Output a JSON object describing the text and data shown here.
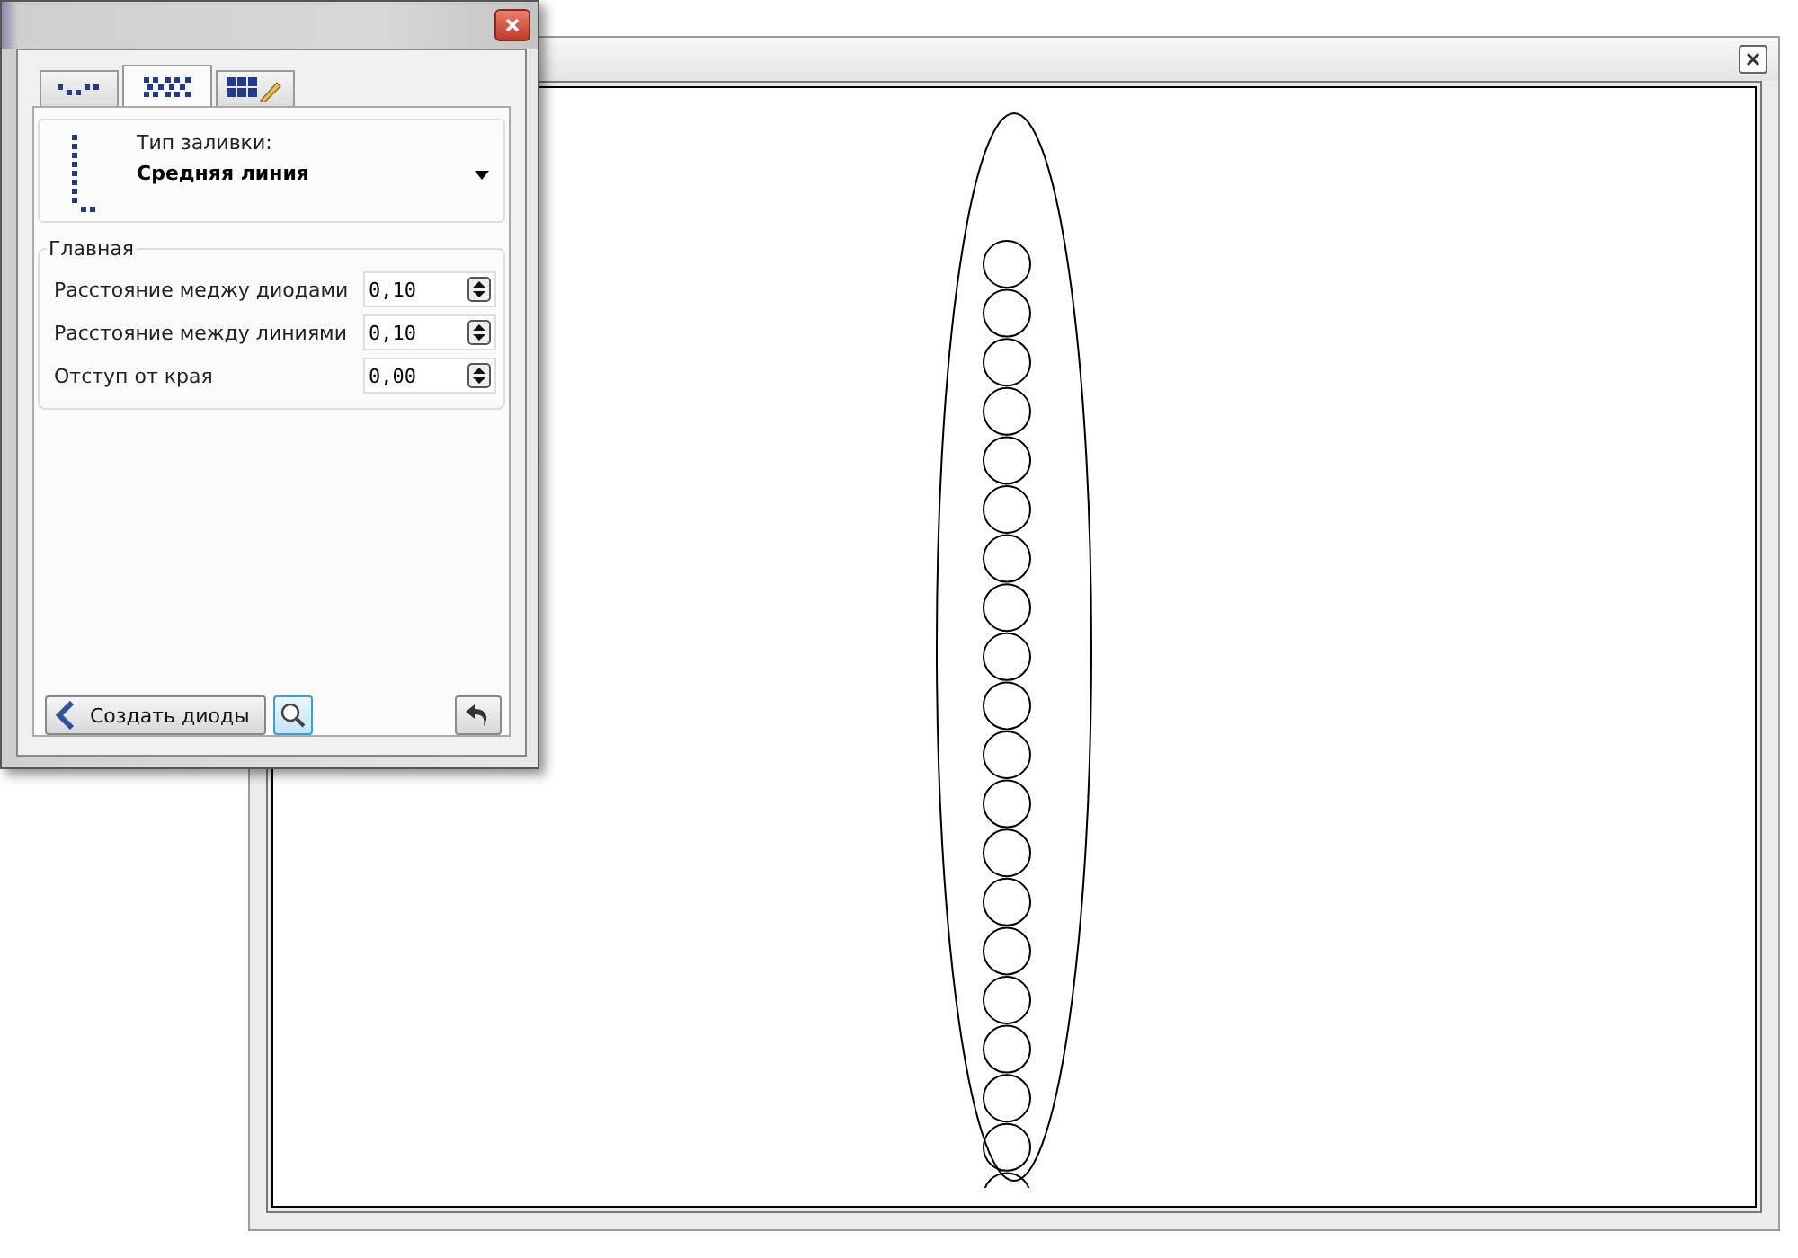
{
  "tabs": [
    {
      "kind": "dots",
      "selected": false
    },
    {
      "kind": "grid",
      "selected": true
    },
    {
      "kind": "edit",
      "selected": false
    }
  ],
  "fill_type": {
    "label": "Тип заливки:",
    "value": "Средняя линия"
  },
  "group": {
    "title": "Главная",
    "fields": [
      {
        "label": "Расстояние меджу диодами",
        "value": "0,10"
      },
      {
        "label": "Расстояние между линиями",
        "value": "0,10"
      },
      {
        "label": "Отступ от края",
        "value": "0,00"
      }
    ]
  },
  "buttons": {
    "create": "Создать диоды",
    "preview_active": true
  }
}
